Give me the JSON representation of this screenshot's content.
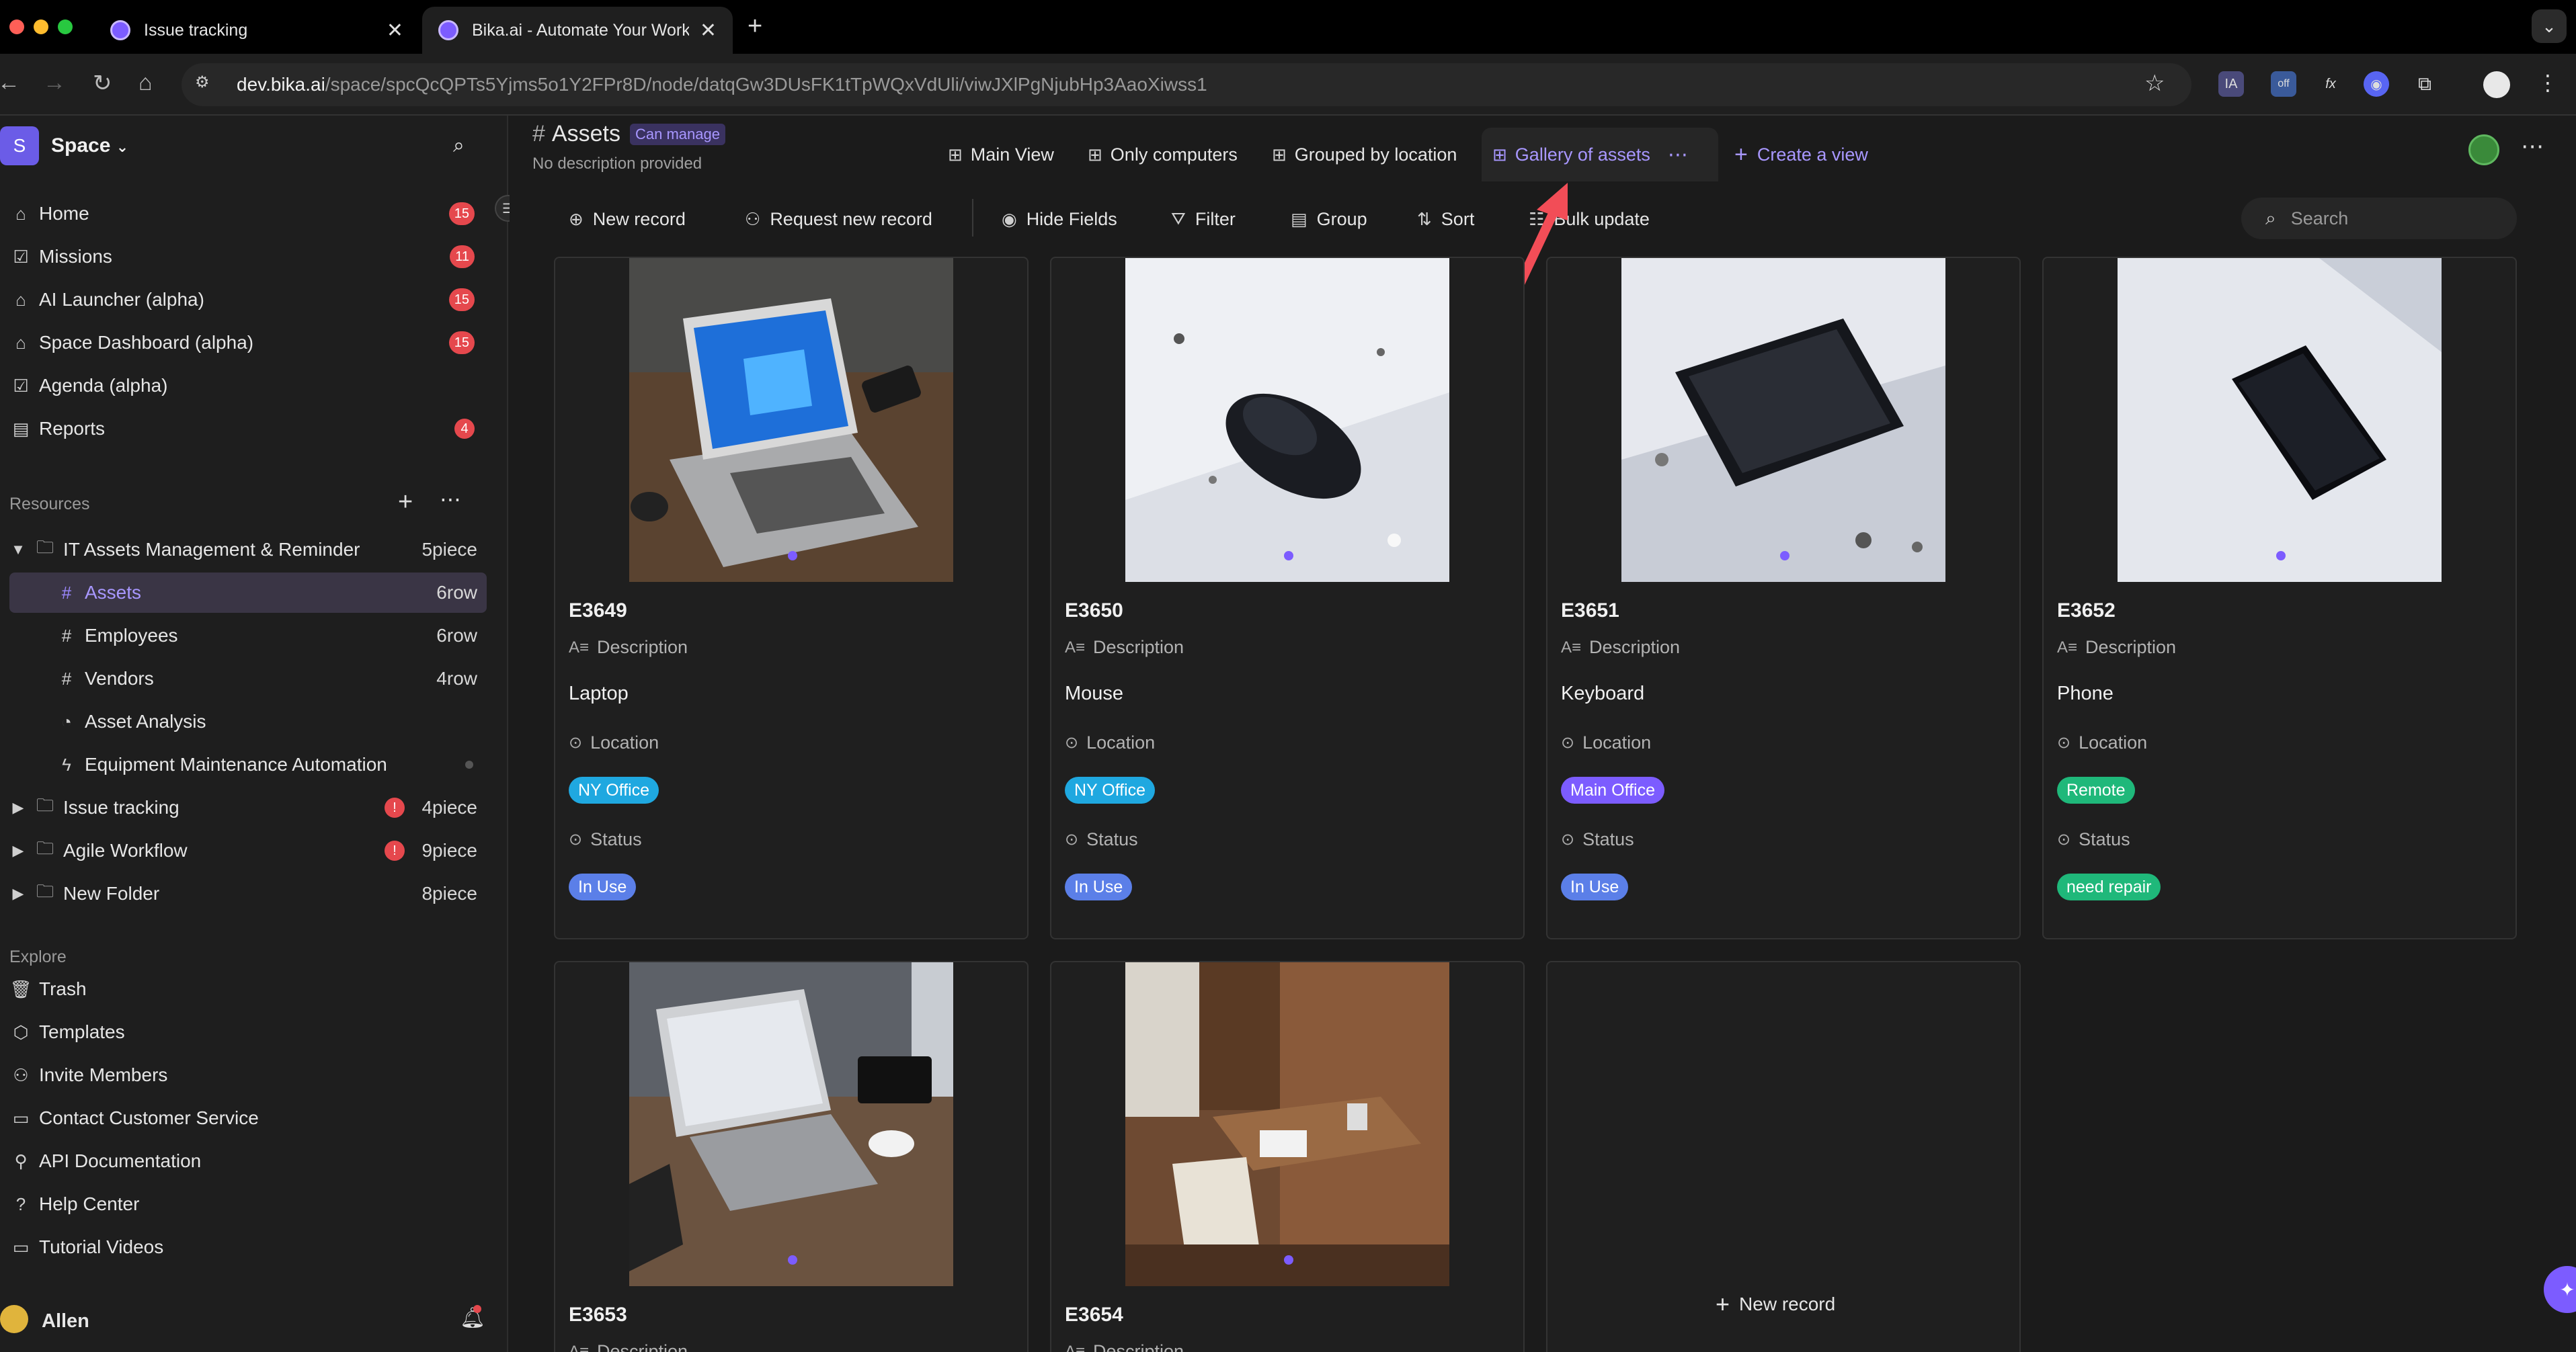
{
  "browser": {
    "tabs": [
      {
        "label": "Issue tracking",
        "active": false
      },
      {
        "label": "Bika.ai - Automate Your Work",
        "active": true
      }
    ],
    "url_host": "dev.bika.ai",
    "url_path": "/space/spcQcQPTs5Yjms5o1Y2FPr8D/node/datqGw3DUsFK1tTpWQxVdUli/viwJXlPgNjubHp3AaoXiwss1",
    "extensions": [
      "IA",
      "off",
      "fx"
    ]
  },
  "sidebar": {
    "space_name": "Space",
    "space_initial": "S",
    "nav": [
      {
        "label": "Home",
        "badge": "15"
      },
      {
        "label": "Missions",
        "badge": "11"
      },
      {
        "label": "AI Launcher (alpha)",
        "badge": "15"
      },
      {
        "label": "Space Dashboard (alpha)",
        "badge": "15"
      },
      {
        "label": "Agenda (alpha)",
        "badge": ""
      },
      {
        "label": "Reports",
        "badge": "4"
      }
    ],
    "resources_label": "Resources",
    "resources": [
      {
        "label": "IT Assets Management & Reminder",
        "count": "5piece"
      },
      {
        "label": "Assets",
        "count": "6row"
      },
      {
        "label": "Employees",
        "count": "6row"
      },
      {
        "label": "Vendors",
        "count": "4row"
      },
      {
        "label": "Asset Analysis",
        "count": ""
      },
      {
        "label": "Equipment Maintenance Automation",
        "count": ""
      },
      {
        "label": "Issue tracking",
        "count": "4piece"
      },
      {
        "label": "Agile Workflow",
        "count": "9piece"
      },
      {
        "label": "New Folder",
        "count": "8piece"
      }
    ],
    "explore_label": "Explore",
    "explore": [
      {
        "label": "Trash"
      },
      {
        "label": "Templates"
      },
      {
        "label": "Invite Members"
      },
      {
        "label": "Contact Customer Service"
      },
      {
        "label": "API Documentation"
      },
      {
        "label": "Help Center"
      },
      {
        "label": "Tutorial Videos"
      }
    ],
    "user_name": "Allen"
  },
  "header": {
    "title": "Assets",
    "permission": "Can manage",
    "description": "No description provided",
    "views": [
      {
        "label": "Main View"
      },
      {
        "label": "Only computers"
      },
      {
        "label": "Grouped by location"
      },
      {
        "label": "Gallery of assets"
      }
    ],
    "create_view": "Create a view"
  },
  "toolbar": {
    "new_record": "New record",
    "request_new_record": "Request new record",
    "hide_fields": "Hide Fields",
    "filter": "Filter",
    "group": "Group",
    "sort": "Sort",
    "bulk_update": "Bulk update",
    "search_placeholder": "Search"
  },
  "gallery": {
    "field_description": "Description",
    "field_location": "Location",
    "field_status": "Status",
    "cards": [
      {
        "code": "E3649",
        "description": "Laptop",
        "location": "NY Office",
        "status": "In Use"
      },
      {
        "code": "E3650",
        "description": "Mouse",
        "location": "NY Office",
        "status": "In Use"
      },
      {
        "code": "E3651",
        "description": "Keyboard",
        "location": "Main Office",
        "status": "In Use"
      },
      {
        "code": "E3652",
        "description": "Phone",
        "location": "Remote",
        "status": "need repair"
      },
      {
        "code": "E3653",
        "description": "",
        "location": "",
        "status": ""
      },
      {
        "code": "E3654",
        "description": "",
        "location": "",
        "status": ""
      }
    ],
    "new_record_label": "New record"
  },
  "colors": {
    "accent": "#7c5cff",
    "tag_ny_office": "#1fa8e0",
    "tag_main_office": "#7c5cff",
    "tag_remote": "#1fb87a",
    "tag_in_use": "#5b7fe8",
    "tag_need_repair": "#1fb87a",
    "badge_red": "#e5484d",
    "annotation_arrow": "#f24d57"
  }
}
